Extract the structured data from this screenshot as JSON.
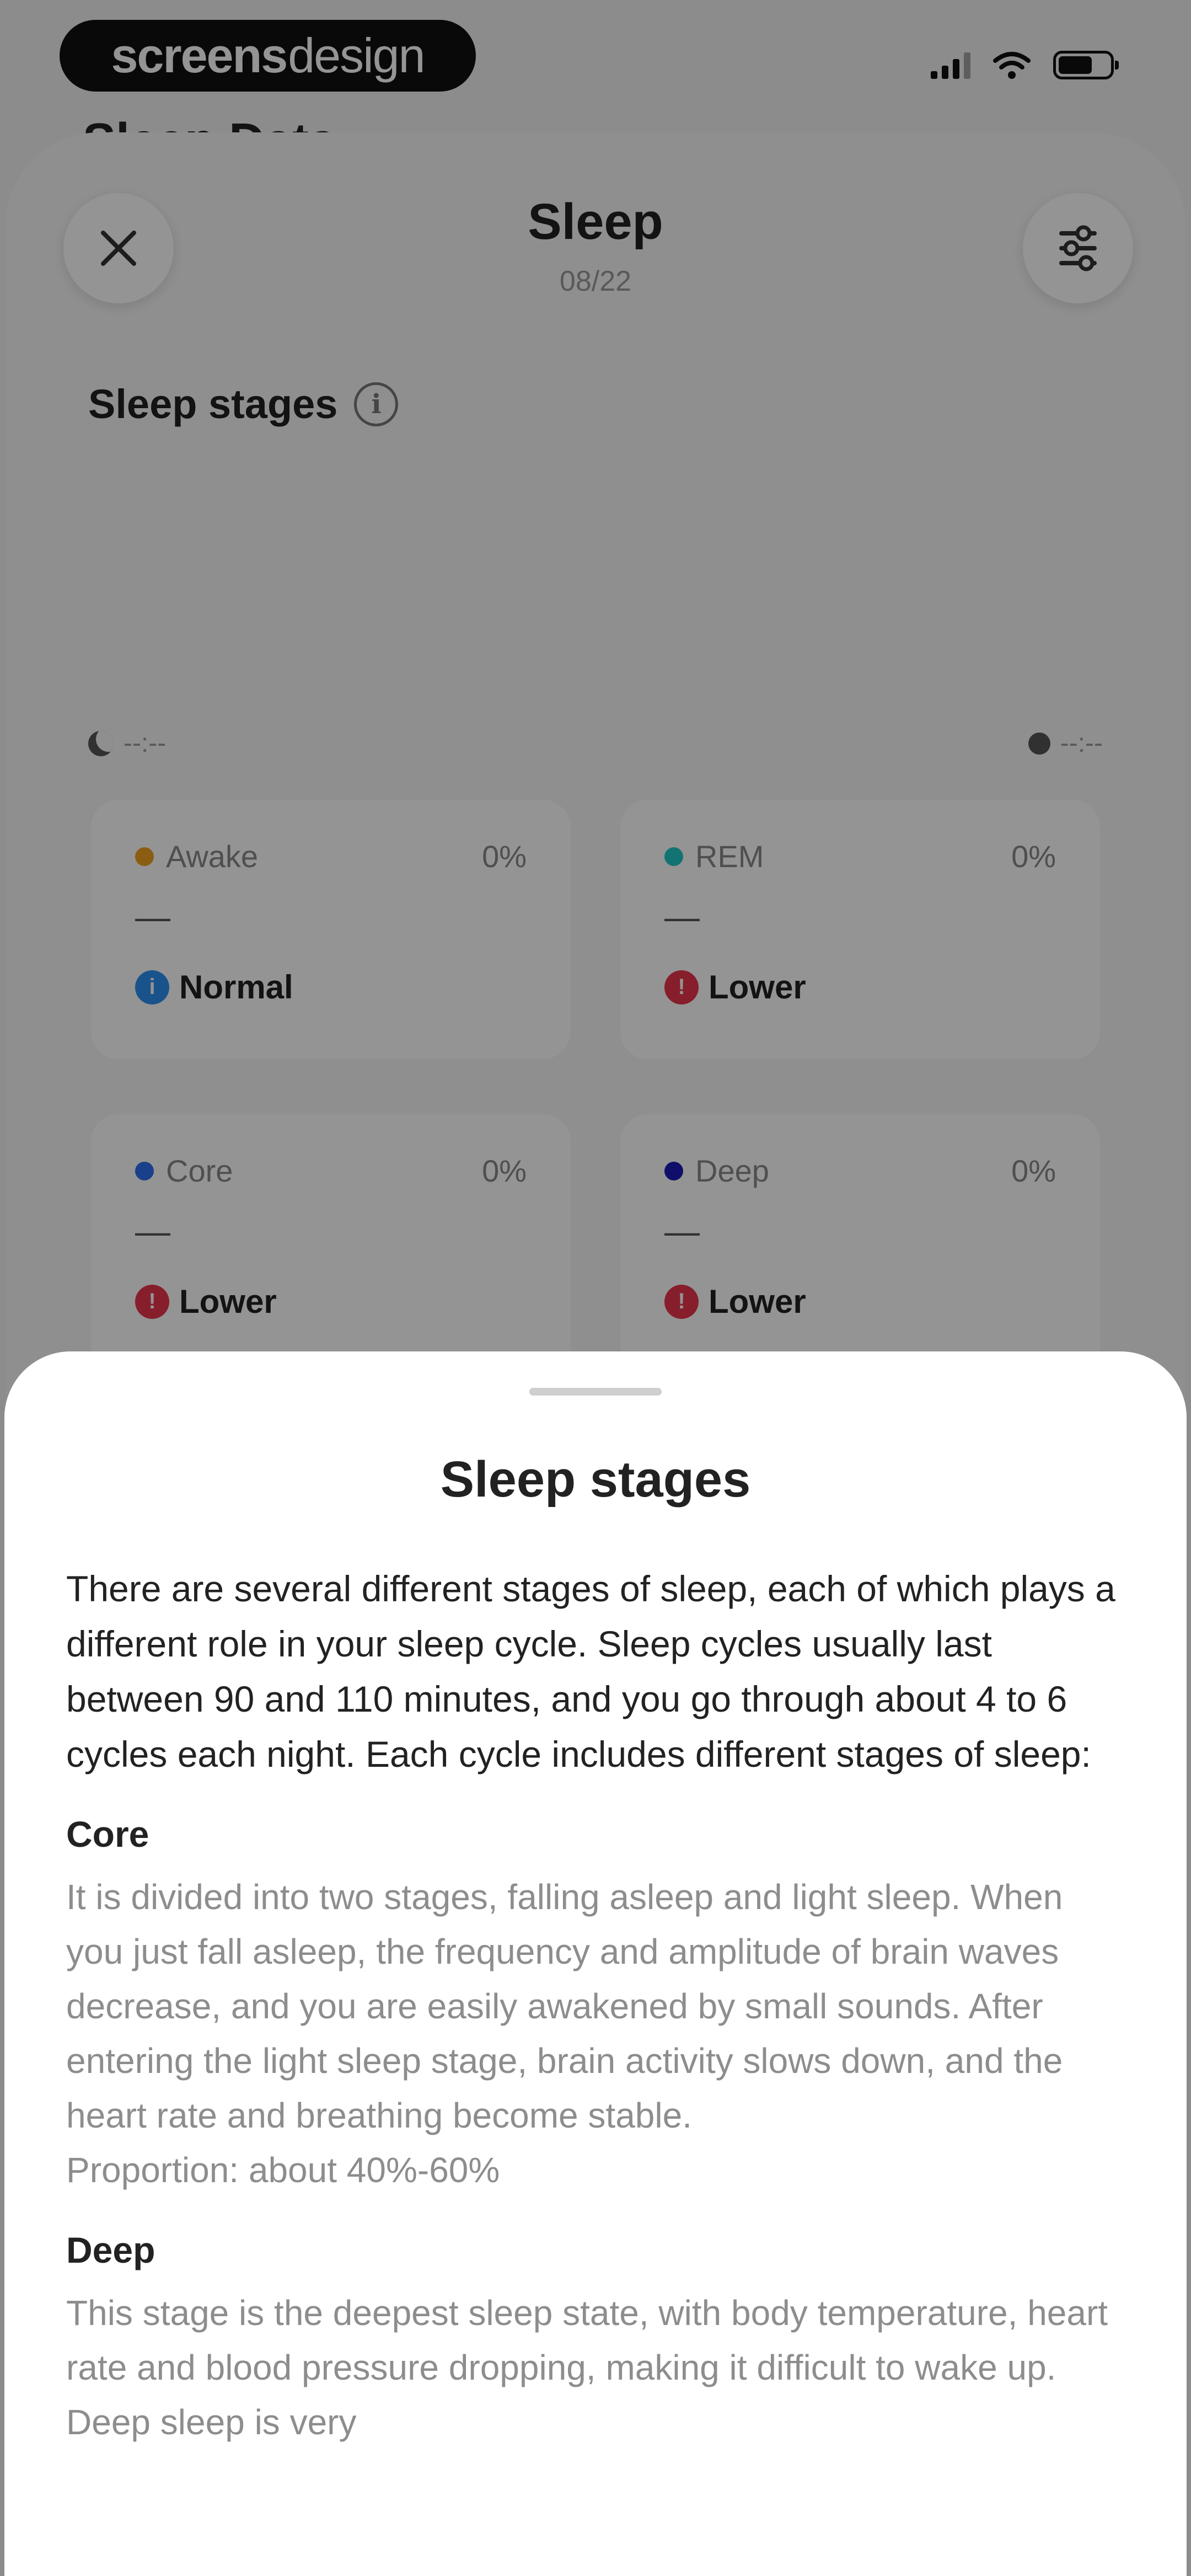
{
  "status_bar": {
    "brand_bold": "screens",
    "brand_light": "design"
  },
  "background_title": "Sleep Data",
  "sheet": {
    "title": "Sleep",
    "date": "08/22",
    "section_label": "Sleep stages",
    "start_time": "--:--",
    "end_time": "--:--",
    "stages": [
      {
        "name": "Awake",
        "percent": "0%",
        "value": "—",
        "status": "Normal",
        "dot_color": "#f0a020",
        "status_color": "#2e8ff0",
        "status_mark": "i"
      },
      {
        "name": "REM",
        "percent": "0%",
        "value": "—",
        "status": "Lower",
        "dot_color": "#22c7c7",
        "status_color": "#e8344a",
        "status_mark": "!"
      },
      {
        "name": "Core",
        "percent": "0%",
        "value": "—",
        "status": "Lower",
        "dot_color": "#2e6ff0",
        "status_color": "#e8344a",
        "status_mark": "!"
      },
      {
        "name": "Deep",
        "percent": "0%",
        "value": "—",
        "status": "Lower",
        "dot_color": "#1a1ab8",
        "status_color": "#e8344a",
        "status_mark": "!"
      }
    ]
  },
  "info": {
    "title": "Sleep stages",
    "intro": "There are several different stages of sleep, each of which plays a different role in your sleep cycle. Sleep cycles usually last between 90 and 110 minutes, and you go through about 4 to 6 cycles each night. Each cycle includes different stages of sleep:",
    "core_heading": "Core",
    "core_text": "It is divided into two stages, falling asleep and light sleep. When you just fall asleep, the frequency and amplitude of brain waves decrease, and you are easily awakened by small sounds. After entering the light sleep stage, brain activity slows down, and the heart rate and breathing become stable.",
    "core_proportion": "Proportion: about 40%-60%",
    "deep_heading": "Deep",
    "deep_text": "This stage is the deepest sleep state, with body temperature, heart rate and blood pressure dropping, making it difficult to wake up. Deep sleep is very"
  }
}
